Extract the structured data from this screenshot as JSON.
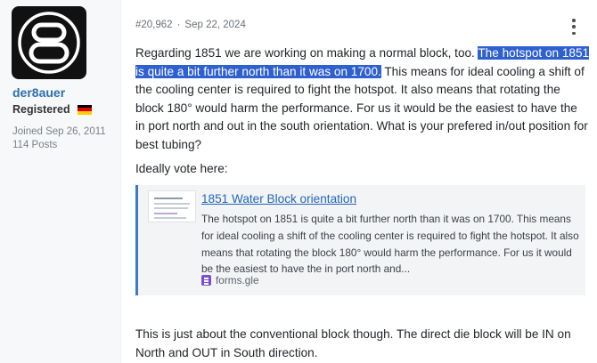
{
  "user": {
    "name": "der8auer",
    "role": "Registered",
    "joined": "Joined Sep 26, 2011",
    "posts": "114 Posts",
    "flag": [
      "#000000",
      "#dd0000",
      "#ffce00"
    ],
    "avatar_bg": "#111111"
  },
  "post": {
    "number": "#20,962",
    "date": "Sep 22, 2024",
    "body_before": "Regarding 1851 we are working on making a normal block, too. ",
    "body_highlight": "The hotspot on 1851 is quite a bit further north than it was on 1700.",
    "body_after": " This means for ideal cooling a shift of the cooling center is required to fight the hotspot. It also means that rotating the block 180° would harm the performance. For us it would be the easiest to have the in port north and out in the south orientation. What is your prefered in/out position for best tubing?",
    "vote_text": "Ideally vote here:",
    "embed": {
      "title": "1851 Water Block orientation",
      "description": "The hotspot on 1851 is quite a bit further north than it was on 1700. This means for ideal cooling a shift of the cooling center is required to fight the hotspot. It also means that rotating the block 180° would harm the performance. For us it would be the easiest to have the in port north and...",
      "source": "forms.gle",
      "accent": "#3a7bc8"
    },
    "footer_text": "This is just about the conventional block though. The direct die block will be IN on North and OUT in South direction.",
    "highlight_color": "#2f60cf",
    "link_color": "#2366b8"
  }
}
